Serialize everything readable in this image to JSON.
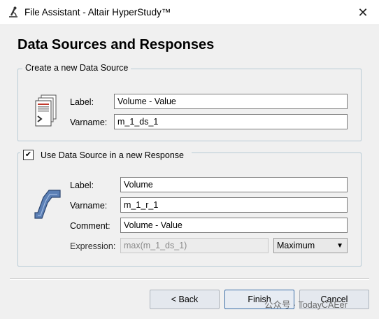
{
  "window": {
    "title": "File Assistant - Altair HyperStudy™",
    "close_glyph": "✕"
  },
  "header": {
    "heading": "Data Sources and Responses"
  },
  "data_source_group": {
    "title": "Create a new Data Source",
    "label_caption": "Label:",
    "label_value": "Volume - Value",
    "varname_caption": "Varname:",
    "varname_value": "m_1_ds_1",
    "icon": "document-stack-icon"
  },
  "response_group": {
    "checkbox_label": "Use Data Source in a new Response",
    "checked": true,
    "check_glyph": "✔",
    "label_caption": "Label:",
    "label_value": "Volume",
    "varname_caption": "Varname:",
    "varname_value": "m_1_r_1",
    "comment_caption": "Comment:",
    "comment_value": "Volume - Value",
    "expression_caption": "Expression:",
    "expression_value": "max(m_1_ds_1)",
    "expression_mode": "Maximum",
    "dropdown_arrow": "▼",
    "icon": "response-curve-icon"
  },
  "footer": {
    "back_label": "< Back",
    "finish_label": "Finish",
    "cancel_label": "Cancel"
  },
  "watermark": "公众号 · TodayCAEer",
  "colors": {
    "group_border": "#b8cbd6",
    "icon_blue": "#4a6fa5",
    "icon_red": "#c0392b"
  }
}
